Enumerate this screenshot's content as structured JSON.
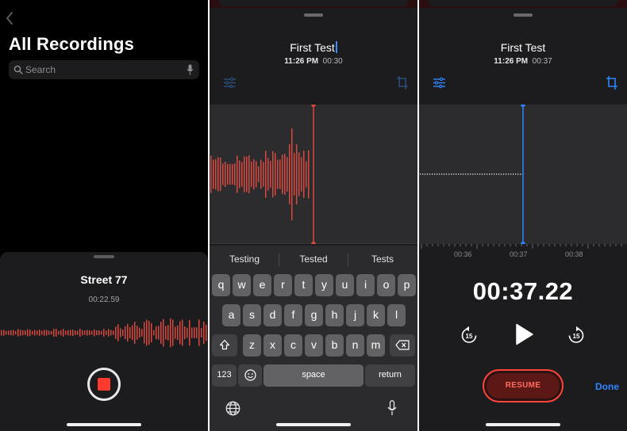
{
  "screen1": {
    "title": "All Recordings",
    "search_placeholder": "Search",
    "recording_name": "Street 77",
    "elapsed": "00:22.59"
  },
  "screen2": {
    "recording_title": "First Test",
    "time": "11:26 PM",
    "duration": "00:30",
    "suggestions": [
      "Testing",
      "Tested",
      "Tests"
    ],
    "keyboard": {
      "row1": [
        "q",
        "w",
        "e",
        "r",
        "t",
        "y",
        "u",
        "i",
        "o",
        "p"
      ],
      "row2": [
        "a",
        "s",
        "d",
        "f",
        "g",
        "h",
        "j",
        "k",
        "l"
      ],
      "row3": [
        "z",
        "x",
        "c",
        "v",
        "b",
        "n",
        "m"
      ],
      "numbers_key": "123",
      "space_key": "space",
      "return_key": "return"
    }
  },
  "screen3": {
    "recording_title": "First Test",
    "time": "11:26 PM",
    "duration": "00:37",
    "ruler_labels": [
      "00:36",
      "00:37",
      "00:38"
    ],
    "playback_time": "00:37.22",
    "skip_back_label": "15",
    "skip_forward_label": "15",
    "resume_label": "RESUME",
    "done_label": "Done"
  },
  "colors": {
    "background": "#000000",
    "sheet": "#1c1c1e",
    "waveform": "#d9493f",
    "record_red": "#ff3b30",
    "accent_blue": "#2e86ff"
  }
}
